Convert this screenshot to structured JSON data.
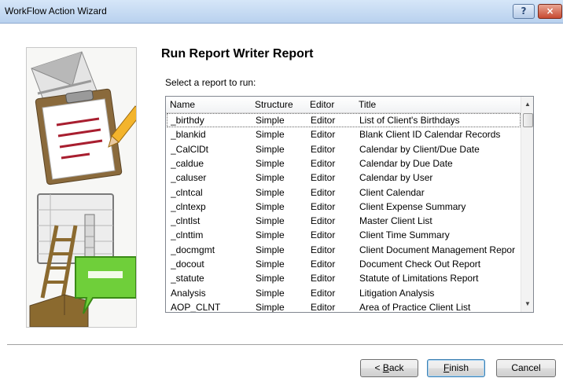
{
  "window": {
    "title": "WorkFlow Action Wizard",
    "help_label": "?",
    "close_label": "×"
  },
  "page": {
    "heading": "Run Report Writer Report",
    "prompt": "Select a report to run:"
  },
  "list": {
    "columns": [
      "Name",
      "Structure",
      "Editor",
      "Title"
    ],
    "rows": [
      [
        "_birthdy",
        "Simple",
        "Editor",
        "List of Client's Birthdays"
      ],
      [
        "_blankid",
        "Simple",
        "Editor",
        "Blank Client ID Calendar Records"
      ],
      [
        "_CalClDt",
        "Simple",
        "Editor",
        "Calendar by Client/Due Date"
      ],
      [
        "_caldue",
        "Simple",
        "Editor",
        "Calendar by Due Date"
      ],
      [
        "_caluser",
        "Simple",
        "Editor",
        "Calendar by User"
      ],
      [
        "_clntcal",
        "Simple",
        "Editor",
        "Client Calendar"
      ],
      [
        "_clntexp",
        "Simple",
        "Editor",
        "Client Expense Summary"
      ],
      [
        "_clntlst",
        "Simple",
        "Editor",
        "Master Client List"
      ],
      [
        "_clnttim",
        "Simple",
        "Editor",
        "Client Time Summary"
      ],
      [
        "_docmgmt",
        "Simple",
        "Editor",
        "Client Document Management Repor"
      ],
      [
        "_docout",
        "Simple",
        "Editor",
        "Document Check Out Report"
      ],
      [
        "_statute",
        "Simple",
        "Editor",
        "Statute of Limitations Report"
      ],
      [
        "Analysis",
        "Simple",
        "Editor",
        "Litigation Analysis"
      ],
      [
        "AOP_CLNT",
        "Simple",
        "Editor",
        "Area of Practice Client List"
      ]
    ]
  },
  "buttons": {
    "back": {
      "prefix": "< ",
      "mnemonic": "B",
      "rest": "ack"
    },
    "finish": {
      "mnemonic": "F",
      "rest": "inish"
    },
    "cancel": {
      "label": "Cancel"
    }
  },
  "colors": {
    "titlebar": "#c3d8f1",
    "close": "#c74a31",
    "envelope_flap": "#b8b8b8",
    "clipboard": "#8a6a3c",
    "pencil": "#f3b42c",
    "tray": "#8b6a2f",
    "bubble": "#6fcf3a"
  },
  "illustration_icons": [
    "envelope-icon",
    "clipboard-icon",
    "pencil-icon",
    "spreadsheet-icon",
    "ladder-icon",
    "speech-bubble-icon"
  ]
}
